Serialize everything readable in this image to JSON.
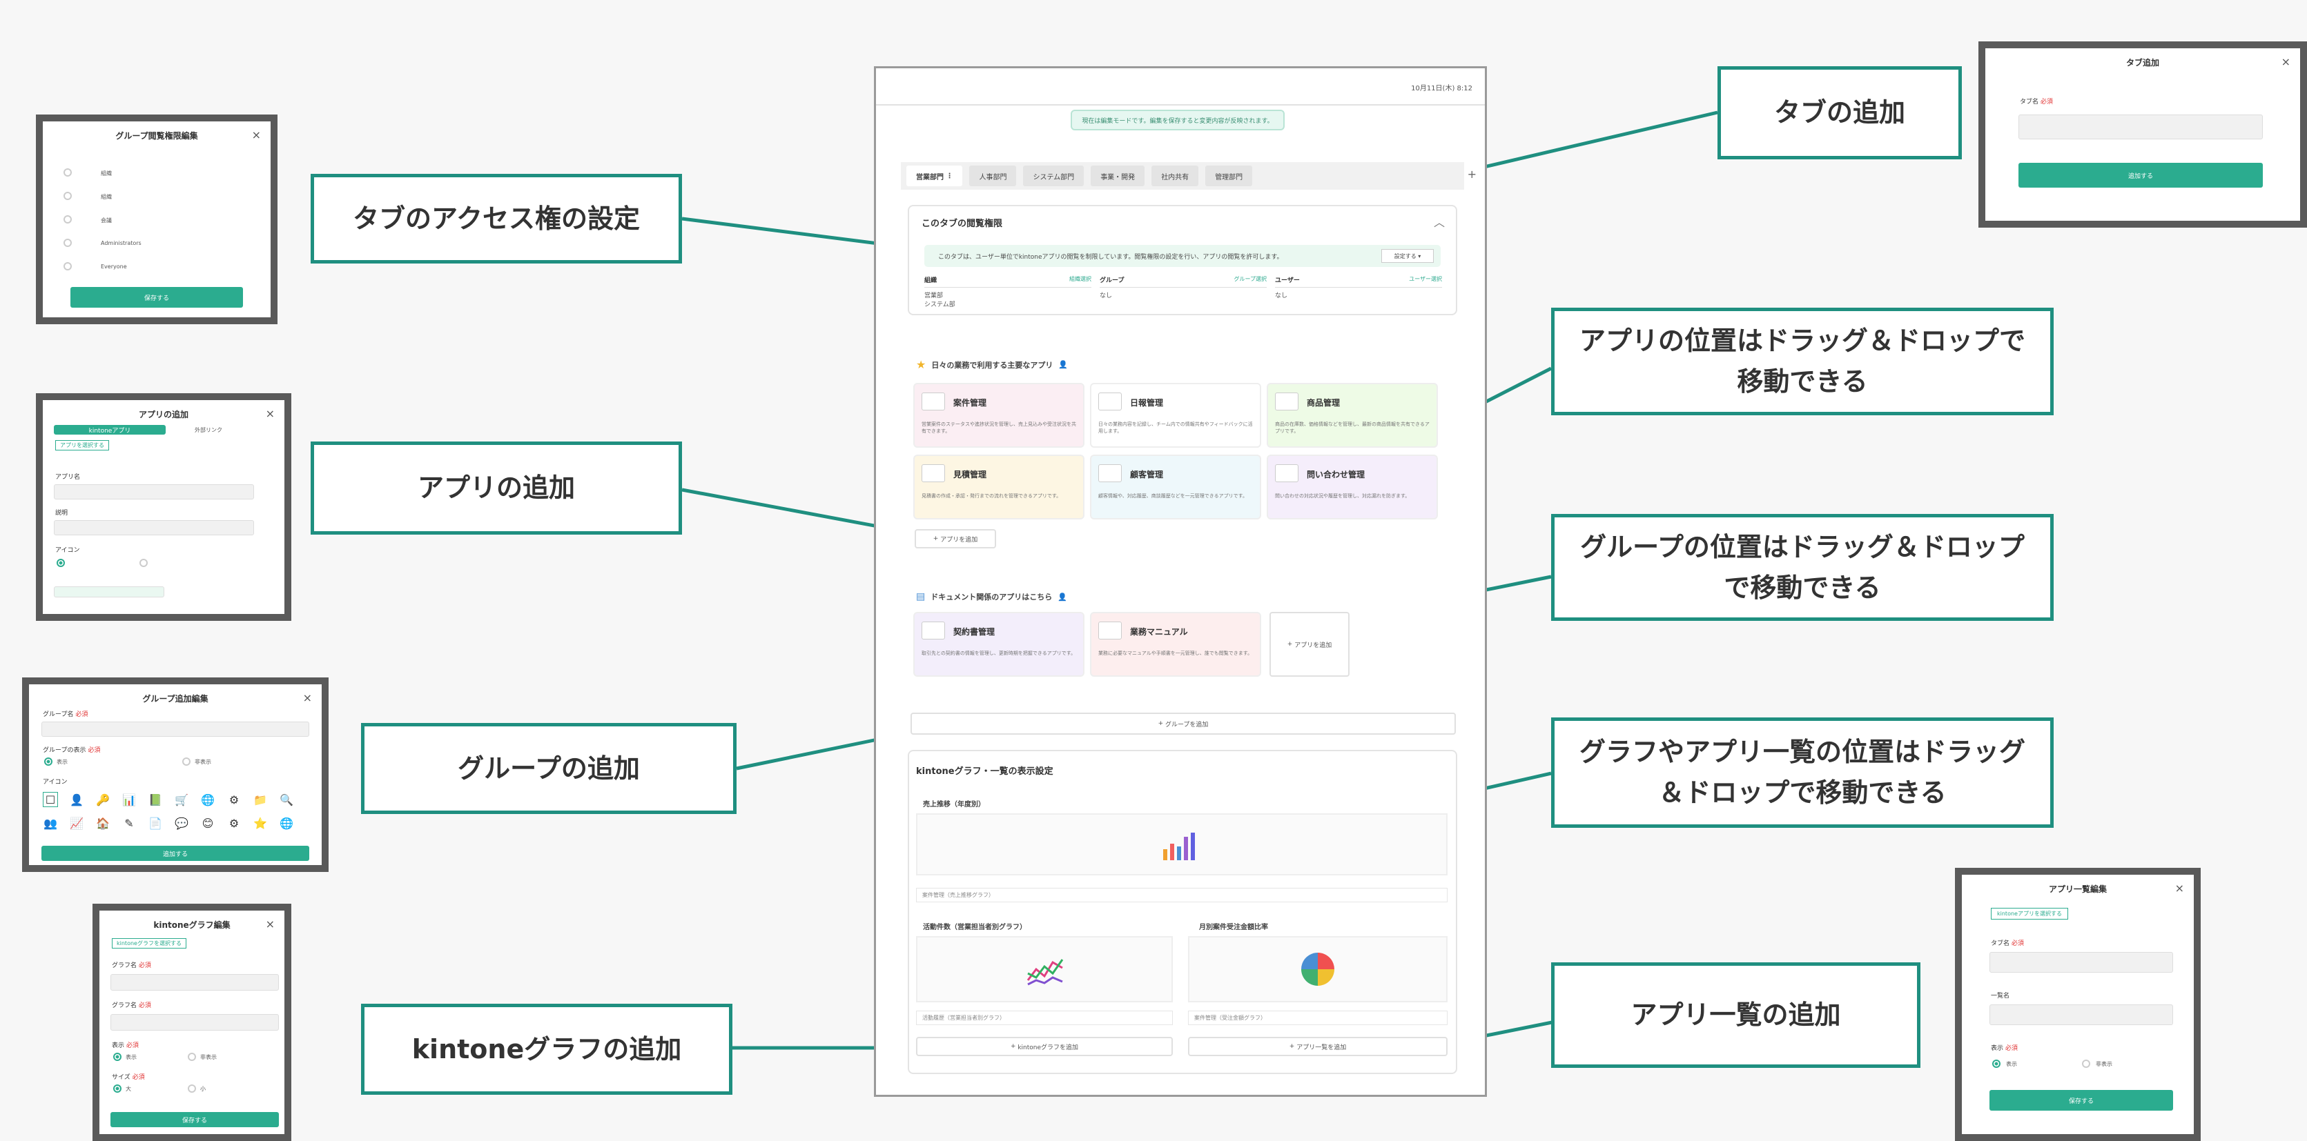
{
  "callouts": {
    "tab_add": "タブの追加",
    "tab_access": "タブのアクセス権の設定",
    "app_drag_line1": "アプリの位置はドラッグ＆ドロップで",
    "app_drag_line2": "移動できる",
    "app_add": "アプリの追加",
    "group_drag_line1": "グループの位置はドラッグ＆ドロップ",
    "group_drag_line2": "で移動できる",
    "group_add": "グループの追加",
    "graph_drag_line1": "グラフやアプリ一覧の位置はドラッグ",
    "graph_drag_line2": "＆ドロップで移動できる",
    "kintone_graph_add": "kintoneグラフの追加",
    "applist_add": "アプリ一覧の追加"
  },
  "main": {
    "date": "10月11日(木) 8:12",
    "notice": "現在は編集モードです。編集を保存すると変更内容が反映されます。",
    "tabs": [
      "営業部門",
      "人事部門",
      "システム部門",
      "事業・開発",
      "社内共有",
      "管理部門"
    ],
    "tab_plus": "+",
    "perm": {
      "title": "このタブの閲覧権限",
      "banner": "このタブは、ユーザー単位でkintoneアプリの閲覧を制限しています。閲覧権限の設定を行い、アプリの閲覧を許可します。",
      "set_button": "設定する",
      "cols": [
        {
          "head": "組織",
          "link": "組織選択",
          "values": [
            "営業部",
            "システム部"
          ]
        },
        {
          "head": "グループ",
          "link": "グループ選択",
          "values": [
            "なし"
          ]
        },
        {
          "head": "ユーザー",
          "link": "ユーザー選択",
          "values": [
            "なし"
          ]
        }
      ]
    },
    "group1": {
      "title": "日々の業務で利用する主要なアプリ",
      "apps": [
        {
          "name": "案件管理",
          "desc": "営業案件のステータスや進捗状況を管理し、売上見込みや受注状況を共有できます。"
        },
        {
          "name": "日報管理",
          "desc": "日々の業務内容を記録し、チーム内での情報共有やフィードバックに活用します。"
        },
        {
          "name": "商品管理",
          "desc": "商品の在庫数、価格情報などを管理し、最新の商品情報を共有できるアプリです。"
        },
        {
          "name": "見積管理",
          "desc": "見積書の作成・承認・発行までの流れを管理できるアプリです。"
        },
        {
          "name": "顧客管理",
          "desc": "顧客情報や、対応履歴、商談履歴などを一元管理できるアプリです。"
        },
        {
          "name": "問い合わせ管理",
          "desc": "問い合わせの対応状況や履歴を管理し、対応漏れを防ぎます。"
        }
      ],
      "add_app": "アプリを追加"
    },
    "group2": {
      "title": "ドキュメント関係のアプリはこちら",
      "apps": [
        {
          "name": "契約書管理",
          "desc": "取引先との契約書の情報を管理し、更新時期を把握できるアプリです。"
        },
        {
          "name": "業務マニュアル",
          "desc": "業務に必要なマニュアルや手順書を一元管理し、誰でも閲覧できます。"
        }
      ],
      "add_app": "アプリを追加"
    },
    "add_group": "グループを追加",
    "graphs": {
      "title": "kintoneグラフ・一覧の表示設定",
      "g1": "売上推移（年度別）",
      "g1_foot": "案件管理（売上推移グラフ）",
      "g2": "活動件数（営業担当者別グラフ）",
      "g2_foot": "活動履歴（営業担当者別グラフ）",
      "g3": "月別案件受注金額比率",
      "g3_foot": "案件管理（受注金額グラフ）",
      "add_graph": "kintoneグラフを追加",
      "add_list": "アプリ一覧を追加"
    }
  },
  "dialogs": {
    "tab_add": {
      "title": "タブ追加",
      "label": "タブ名",
      "req": "必須",
      "button": "追加する"
    },
    "group_perm": {
      "title": "グループ閲覧権限編集",
      "rows": [
        "組織",
        "組織",
        "会議",
        "Administrators",
        "Everyone"
      ],
      "button": "保存する"
    },
    "app_add": {
      "title": "アプリの追加",
      "tab1": "kintoneアプリ",
      "tab2": "外部リンク",
      "button": "アプリを選択する",
      "lbl1": "アプリ名",
      "lbl2": "説明",
      "lbl3": "アイコン"
    },
    "group_add": {
      "title": "グループ追加編集",
      "lbl1": "グループ名",
      "lbl2": "グループの表示",
      "lbl3": "アイコン",
      "opt1": "表示",
      "opt2": "非表示",
      "req": "必須",
      "button": "追加する",
      "icons": [
        "☐",
        "👤",
        "🔑",
        "📊",
        "📗",
        "🛒",
        "🌐",
        "⚙",
        "📁",
        "🔍",
        "👥",
        "📈",
        "🏠",
        "✎",
        "📄",
        "💬",
        "😊",
        "⚙",
        "⭐",
        "🌐"
      ]
    },
    "kintone_graph": {
      "title": "kintoneグラフ編集",
      "pill": "kintoneグラフを選択する",
      "lbl1": "グラフ名",
      "lbl2": "グラフ名",
      "lbl3": "表示",
      "lbl4": "サイズ",
      "opt1": "表示",
      "opt2": "非表示",
      "opt3": "大",
      "opt4": "小",
      "req": "必須",
      "button": "保存する"
    },
    "applist": {
      "title": "アプリ一覧編集",
      "pill": "kintoneアプリを選択する",
      "lbl1": "タブ名",
      "lbl2": "一覧名",
      "lbl3": "表示",
      "opt1": "表示",
      "opt2": "非表示",
      "req": "必須",
      "button": "保存する"
    }
  },
  "colors": {
    "teal": "#1f8f80",
    "accent_green": "#2bac8f"
  }
}
